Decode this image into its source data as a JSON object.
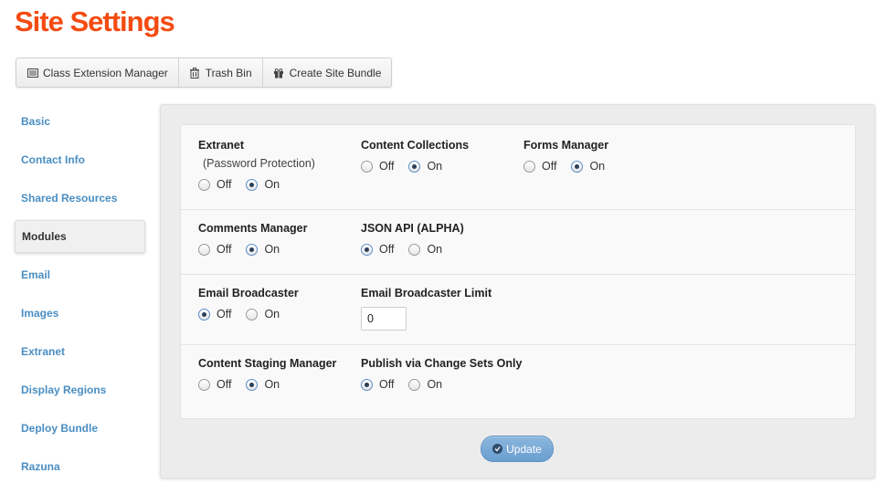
{
  "page": {
    "title": "Site Settings"
  },
  "toolbar": {
    "buttons": [
      {
        "label": "Class Extension Manager",
        "icon": "list-icon"
      },
      {
        "label": "Trash Bin",
        "icon": "trash-icon"
      },
      {
        "label": "Create Site Bundle",
        "icon": "gift-icon"
      }
    ]
  },
  "sidebar": {
    "items": [
      {
        "label": "Basic",
        "active": false
      },
      {
        "label": "Contact Info",
        "active": false
      },
      {
        "label": "Shared Resources",
        "active": false
      },
      {
        "label": "Modules",
        "active": true
      },
      {
        "label": "Email",
        "active": false
      },
      {
        "label": "Images",
        "active": false
      },
      {
        "label": "Extranet",
        "active": false
      },
      {
        "label": "Display Regions",
        "active": false
      },
      {
        "label": "Deploy Bundle",
        "active": false
      },
      {
        "label": "Razuna",
        "active": false
      }
    ]
  },
  "settings": {
    "radio_labels": {
      "off": "Off",
      "on": "On"
    },
    "extranet": {
      "label": "Extranet",
      "sublabel": "(Password Protection)",
      "value": "On"
    },
    "content_collections": {
      "label": "Content Collections",
      "value": "On"
    },
    "forms_manager": {
      "label": "Forms Manager",
      "value": "On"
    },
    "comments_manager": {
      "label": "Comments Manager",
      "value": "On"
    },
    "json_api": {
      "label": "JSON API (ALPHA)",
      "value": "Off"
    },
    "email_broadcaster": {
      "label": "Email Broadcaster",
      "value": "Off"
    },
    "email_broadcaster_limit": {
      "label": "Email Broadcaster Limit",
      "value": "0"
    },
    "content_staging_manager": {
      "label": "Content Staging Manager",
      "value": "On"
    },
    "publish_via_change_sets": {
      "label": "Publish via Change Sets Only",
      "value": "Off"
    }
  },
  "actions": {
    "update_label": "Update"
  },
  "colors": {
    "title": "#f44b12",
    "link": "#4a8ec2",
    "button": "#6a9fd0"
  }
}
